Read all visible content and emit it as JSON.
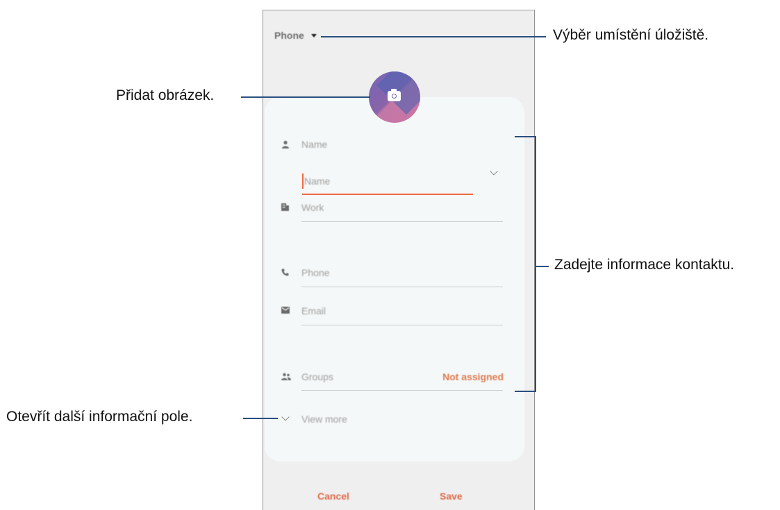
{
  "phone": {
    "storage_label": "Phone",
    "form": {
      "name_label": "Name",
      "name_placeholder": "Name",
      "work_label": "Work",
      "phone_label": "Phone",
      "email_label": "Email",
      "groups_label": "Groups",
      "groups_value": "Not assigned",
      "view_more": "View more"
    },
    "buttons": {
      "cancel": "Cancel",
      "save": "Save"
    },
    "icons": [
      "camera-icon",
      "person-icon",
      "building-icon",
      "phone-icon",
      "email-icon",
      "groups-icon",
      "chevron-down-icon"
    ],
    "accent_color": "#f06a3e"
  },
  "callouts": {
    "storage": "Výběr umístění úložiště.",
    "picture": "Přidat obrázek.",
    "contact_info": "Zadejte informace kontaktu.",
    "more_fields": "Otevřít další informační pole."
  }
}
